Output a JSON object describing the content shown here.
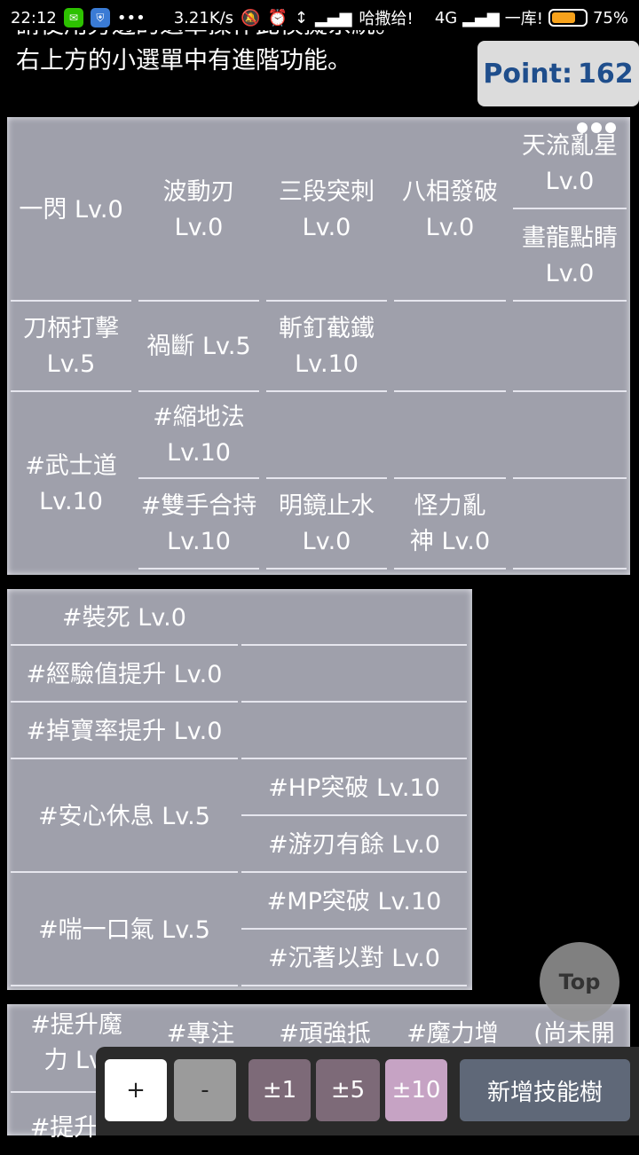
{
  "status_bar": {
    "time": "22:12",
    "more": "•••",
    "speed": "3.21K/s",
    "carrier1": "哈撒给!",
    "network": "4G",
    "carrier2": "一库!",
    "battery": "75%",
    "battery_level": 0.75
  },
  "intro": {
    "line1": "請使用旁邊的選單操作此模擬系統。",
    "line2": "右上方的小選單中有進階功能。"
  },
  "point": {
    "label": "Point:",
    "value": "162"
  },
  "tree1": {
    "cells": [
      "一閃 Lv.0",
      "波動刃 Lv.0",
      "三段突刺 Lv.0",
      "八相發破 Lv.0",
      "天流亂星 Lv.0",
      "畫龍點睛 Lv.0",
      "刀柄打擊 Lv.5",
      "禍斷 Lv.5",
      "斬釘截鐵 Lv.10",
      "#武士道 Lv.10",
      "#縮地法 Lv.10",
      "#雙手合持 Lv.10",
      "明鏡止水 Lv.0",
      "怪力亂神 Lv.0"
    ]
  },
  "tree2": {
    "cells": [
      "#裝死 Lv.0",
      "#經驗值提升 Lv.0",
      "#掉寶率提升 Lv.0",
      "#安心休息 Lv.5",
      "#HP突破 Lv.10",
      "#游刃有餘 Lv.0",
      "#喘一口氣 Lv.5",
      "#MP突破 Lv.10",
      "#沉著以對 Lv.0"
    ]
  },
  "tree3": {
    "cells": [
      "#提升魔力 Lv.",
      "#專注",
      "#頑強抵",
      "#魔力增",
      "(尚未開",
      "#提升"
    ]
  },
  "top_button": "Top",
  "toolbar": {
    "plus": "+",
    "minus": "-",
    "pm1": "±1",
    "pm5": "±5",
    "pm10": "±10",
    "add_tree": "新增技能樹"
  },
  "colors": {
    "panel": "#9fa0ab",
    "point_text": "#1f4e8c",
    "pm_button": "#7d6a78",
    "pm_active": "#c6a3c4",
    "add_tree_button": "#5f6878"
  }
}
